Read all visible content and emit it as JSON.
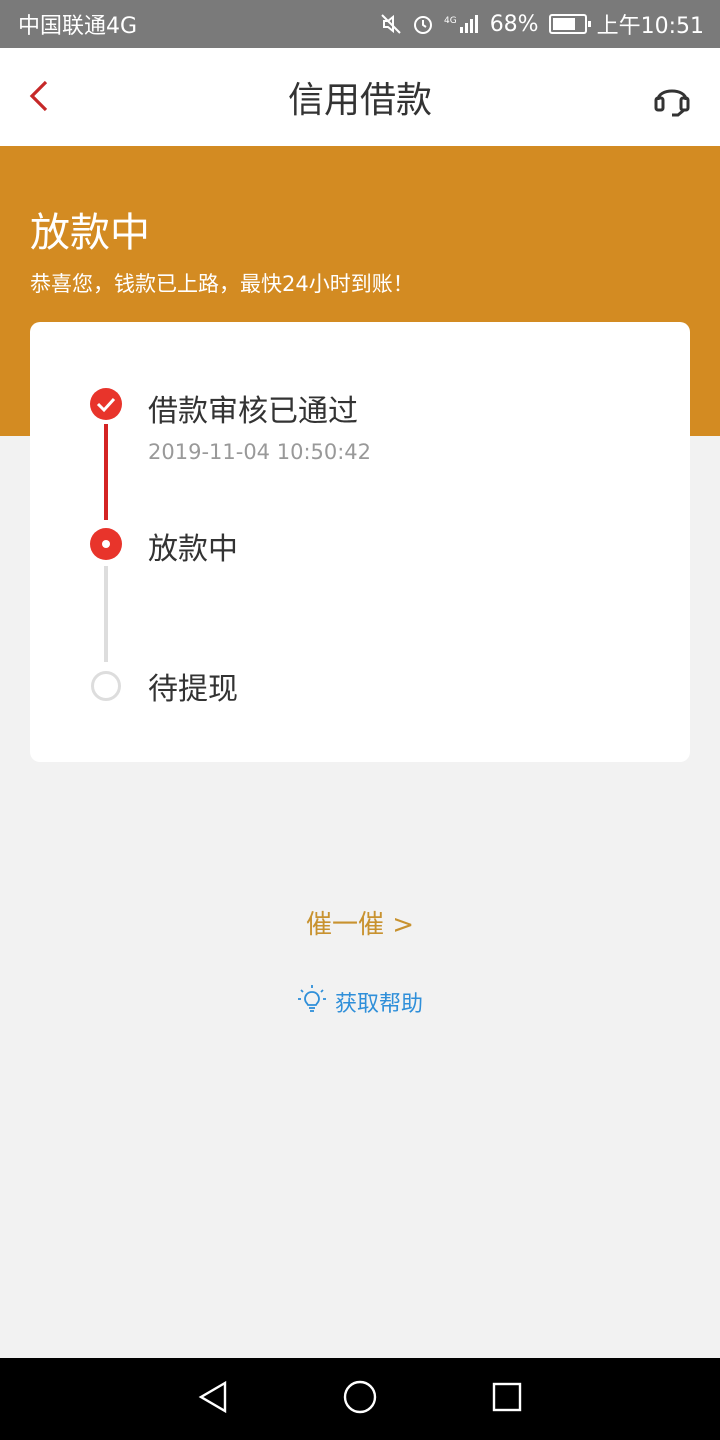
{
  "status_bar": {
    "carrier": "中国联通4G",
    "network": "4G",
    "battery": "68%",
    "time": "上午10:51"
  },
  "nav": {
    "title": "信用借款"
  },
  "hero": {
    "title": "放款中",
    "subtitle": "恭喜您，钱款已上路，最快24小时到账！"
  },
  "steps": [
    {
      "label": "借款审核已通过",
      "time": "2019-11-04 10:50:42",
      "state": "done"
    },
    {
      "label": "放款中",
      "time": "",
      "state": "active"
    },
    {
      "label": "待提现",
      "time": "",
      "state": "pending"
    }
  ],
  "actions": {
    "urge": "催一催 >",
    "help": "获取帮助"
  },
  "colors": {
    "accent": "#d38b22",
    "step_red": "#e8342b",
    "help_blue": "#2f8fd9"
  }
}
